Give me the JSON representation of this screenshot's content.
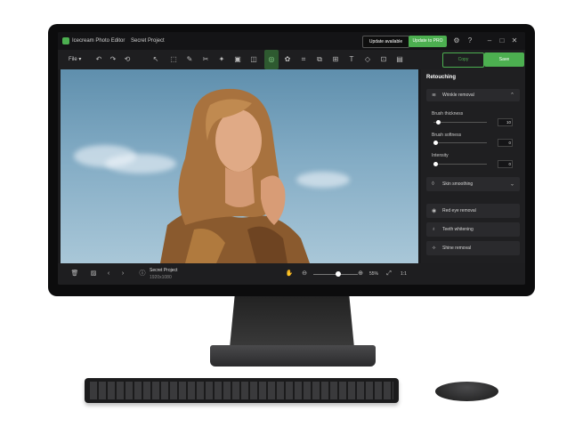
{
  "app": {
    "name": "Icecream Photo Editor",
    "project": "Secret Project",
    "update_label": "Update available",
    "pro_label": "Update to PRO"
  },
  "toolbar": {
    "file_label": "File ▾",
    "copy_label": "Copy",
    "save_label": "Save"
  },
  "panel": {
    "title": "Retouching",
    "wrinkle_label": "Wrinkle removal",
    "sliders": [
      {
        "label": "Brush thickness",
        "value": "10",
        "level": 0.05
      },
      {
        "label": "Brush softness",
        "value": "0",
        "level": 0.0
      },
      {
        "label": "Intensity",
        "value": "0",
        "level": 0.0
      }
    ],
    "skin_label": "Skin smoothing",
    "redeye_label": "Red eye removal",
    "teeth_label": "Teeth whitening",
    "shine_label": "Shine removal"
  },
  "bottom": {
    "file_name": "Secret Project",
    "file_dims": "1920x1080",
    "zoom": "55%",
    "ratio": "1:1",
    "zoom_level": 0.55
  },
  "colors": {
    "accent": "#4caf50",
    "bg": "#1e1e20"
  }
}
